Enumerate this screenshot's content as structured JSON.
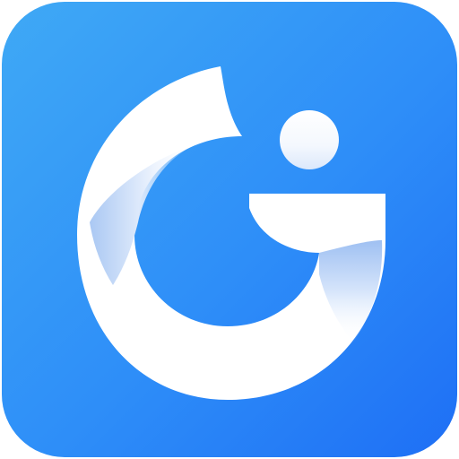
{
  "icon": {
    "name": "stylized-g-app-icon",
    "colors": {
      "background_light": "#3fa9f5",
      "background_mid": "#2e8ef8",
      "background_dark": "#1e6ff5",
      "glyph": "#ffffff",
      "glyph_shadow": "#c9dcf7",
      "dot_shadow": "#dbe8fb"
    }
  }
}
